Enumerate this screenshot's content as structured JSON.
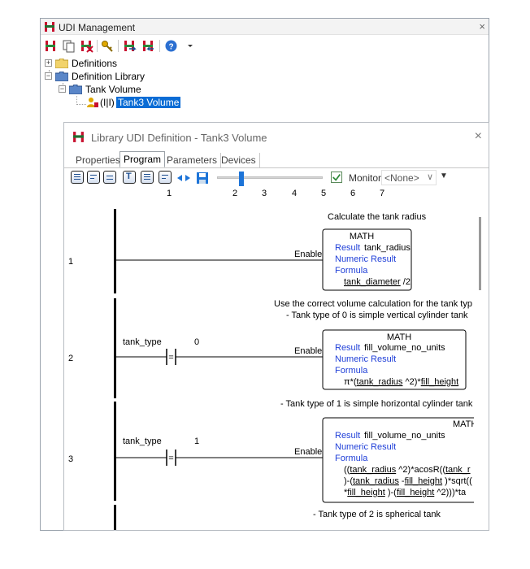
{
  "udi_window": {
    "title": "UDI Management",
    "close": "×"
  },
  "tree": {
    "definitions": "Definitions",
    "definition_library": "Definition Library",
    "tank_volume": "Tank Volume",
    "tank3_prefix": "(I|I)",
    "tank3_volume": "Tank3 Volume"
  },
  "lib_window": {
    "title": "Library UDI Definition - Tank3 Volume",
    "close": "×"
  },
  "tabs": [
    "Properties",
    "Program",
    "Parameters",
    "Devices"
  ],
  "monitor": {
    "label": "Monitor",
    "value": "<None>"
  },
  "columns": [
    "1",
    "2",
    "3",
    "4",
    "5",
    "6",
    "7"
  ],
  "rungs": [
    {
      "number": "1",
      "comment": [
        "Calculate the tank radius"
      ],
      "enable": "Enable",
      "block": {
        "title": "MATH",
        "result_label": "Result",
        "result_value": "tank_radius",
        "numeric": "Numeric Result",
        "formula_label": "Formula",
        "formula": [
          [
            "u",
            "tank_diameter"
          ],
          [
            "t",
            " /2"
          ]
        ]
      }
    },
    {
      "number": "2",
      "comment": [
        "Use the correct volume calculation for the tank typ",
        "- Tank type of 0 is simple vertical cylinder tank"
      ],
      "contact_tag": "tank_type",
      "contact_value": "0",
      "contact_symbol": "=",
      "enable": "Enable",
      "block": {
        "title": "MATH",
        "result_label": "Result",
        "result_value": "fill_volume_no_units",
        "numeric": "Numeric Result",
        "formula_label": "Formula",
        "formula": [
          [
            "t",
            "π*("
          ],
          [
            "u",
            "tank_radius"
          ],
          [
            "t",
            " ^2)*"
          ],
          [
            "u",
            "fill_height"
          ]
        ]
      }
    },
    {
      "number": "3",
      "comment": [
        "- Tank type of 1 is simple horizontal cylinder tank"
      ],
      "contact_tag": "tank_type",
      "contact_value": "1",
      "contact_symbol": "=",
      "enable": "Enable",
      "block": {
        "title": "MATH",
        "result_label": "Result",
        "result_value": "fill_volume_no_units",
        "numeric": "Numeric Result",
        "formula_label": "Formula",
        "formula_lines": [
          [
            [
              "t",
              "(("
            ],
            [
              "u",
              "tank_radius"
            ],
            [
              "t",
              " ^2)*acosR(("
            ],
            [
              "u",
              "tank_r"
            ]
          ],
          [
            [
              "t",
              ")-("
            ],
            [
              "u",
              "tank_radius"
            ],
            [
              "t",
              " -"
            ],
            [
              "u",
              "fill_height"
            ],
            [
              "t",
              " )*sqrt(("
            ]
          ],
          [
            [
              "t",
              "*"
            ],
            [
              "u",
              "fill_height"
            ],
            [
              "t",
              " )-("
            ],
            [
              "u",
              "fill_height"
            ],
            [
              "t",
              " ^2)))*ta"
            ]
          ]
        ]
      }
    },
    {
      "comment": [
        "- Tank type of 2 is spherical tank"
      ]
    }
  ],
  "colors": {
    "selection": "#0a6cd5",
    "keyword_blue": "#1f3fd8",
    "rail": "#000000",
    "slider": "#1d74d8"
  }
}
